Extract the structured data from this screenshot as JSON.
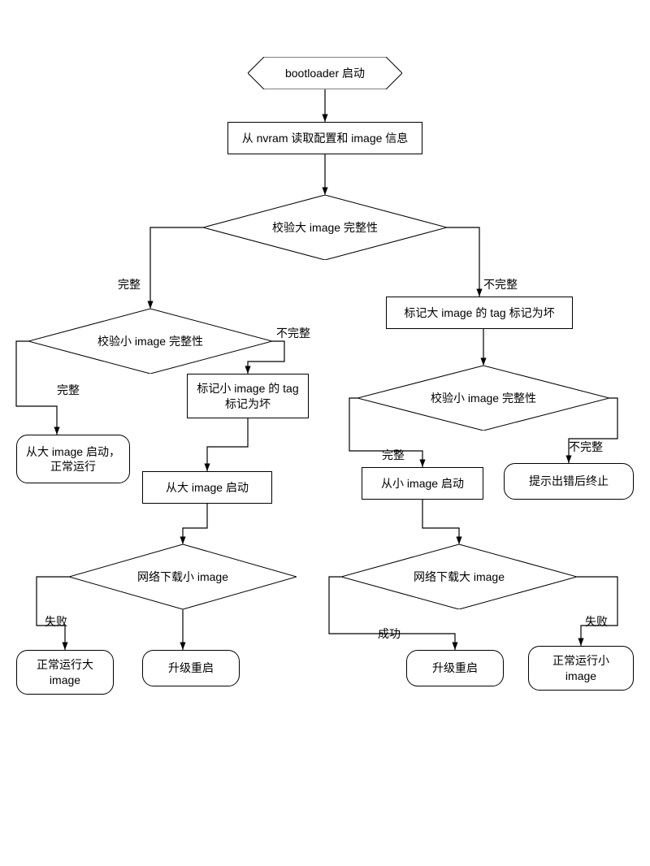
{
  "nodes": {
    "start": "bootloader 启动",
    "readNvram": "从 nvram 读取配置和 image 信息",
    "verifyBig": "校验大 image 完整性",
    "verifySmallLeft": "校验小 image 完整性",
    "markBigBad": "标记大 image 的 tag 标记为坏",
    "verifySmallRight": "校验小 image 完整性",
    "bootBigNormal": "从大 image 启动，正常运行",
    "markSmallBad": "标记小 image 的 tag 标记为坏",
    "bootBig": "从大 image 启动",
    "bootSmall": "从小 image 启动",
    "errorStop": "提示出错后终止",
    "dlSmall": "网络下载小 image",
    "dlBig": "网络下载大 image",
    "runBig": "正常运行大 image",
    "rebootLeft": "升级重启",
    "rebootRight": "升级重启",
    "runSmall": "正常运行小 image"
  },
  "edges": {
    "complete": "完整",
    "incomplete": "不完整",
    "success": "成功",
    "fail": "失败"
  }
}
